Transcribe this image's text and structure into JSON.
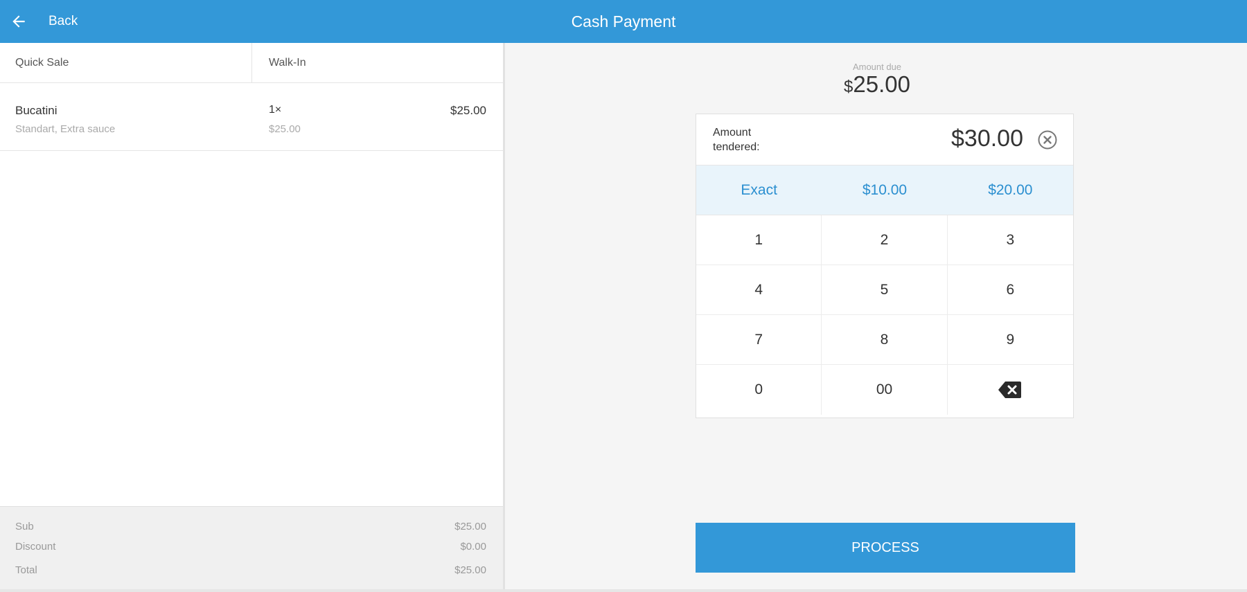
{
  "header": {
    "back_label": "Back",
    "title": "Cash Payment",
    "icons": {
      "back": "arrow-left-icon"
    },
    "color": "#3398d8"
  },
  "order": {
    "columns": [
      "Quick Sale",
      "Walk-In"
    ],
    "items": [
      {
        "name": "Bucatini",
        "modifiers": "Standart, Extra sauce",
        "quantity": "1×",
        "unit_price": "$25.00",
        "price": "$25.00"
      }
    ],
    "totals": [
      {
        "label": "Sub",
        "value": "$25.00"
      },
      {
        "label": "Discount",
        "value": "$0.00"
      },
      {
        "label": "Total",
        "value": "$25.00"
      }
    ]
  },
  "payment": {
    "amount_due_label": "Amount due",
    "amount_due_currency": "$",
    "amount_due_value": "25.00",
    "amount_tendered_label_line1": "Amount",
    "amount_tendered_label_line2": "tendered:",
    "amount_tendered_value": "$30.00",
    "clear_icon": "clear-circle-icon",
    "quick_amounts": [
      "Exact",
      "$10.00",
      "$20.00"
    ],
    "keys": [
      "1",
      "2",
      "3",
      "4",
      "5",
      "6",
      "7",
      "8",
      "9",
      "0",
      "00"
    ],
    "backspace_icon": "backspace-icon",
    "process_label": "PROCESS",
    "accent_color": "#2b8fd0"
  }
}
